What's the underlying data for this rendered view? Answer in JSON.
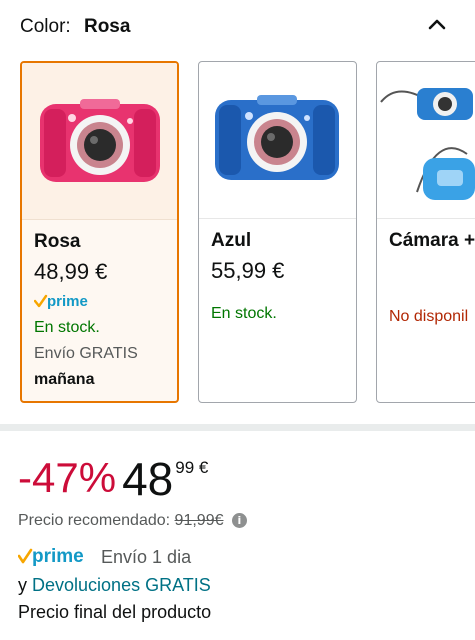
{
  "header": {
    "color_label": "Color:",
    "color_value": "Rosa",
    "icon": "chevron-up-icon"
  },
  "variants": [
    {
      "name": "Rosa",
      "price": "48,99 €",
      "prime": "prime",
      "stock": "En stock.",
      "shipping": "Envío GRATIS",
      "shipping_day": "mañana",
      "selected": true,
      "color": "#e8336f"
    },
    {
      "name": "Azul",
      "price": "55,99 €",
      "stock": "En stock.",
      "selected": false,
      "color": "#2a6fc9"
    },
    {
      "name": "Cámara +",
      "stock": "No disponil",
      "selected": false,
      "color": "#2a7fd0"
    }
  ],
  "deal": {
    "discount": "-47%",
    "price_whole": "48",
    "price_fraction": "99",
    "currency": "€",
    "recommended_label": "Precio recomendado:",
    "recommended_price": "91,99€",
    "info_icon": "i"
  },
  "delivery": {
    "prime": "prime",
    "text": "Envío 1 dia",
    "returns_prefix": "y",
    "returns_link": "Devoluciones GRATIS",
    "final_price": "Precio final del producto"
  },
  "colors": {
    "accent": "#e77600",
    "discount": "#cc0c39",
    "in_stock": "#007600",
    "unavailable": "#b12704",
    "link": "#007185",
    "prime_blue": "#1399c6",
    "prime_check": "#f7a600"
  }
}
